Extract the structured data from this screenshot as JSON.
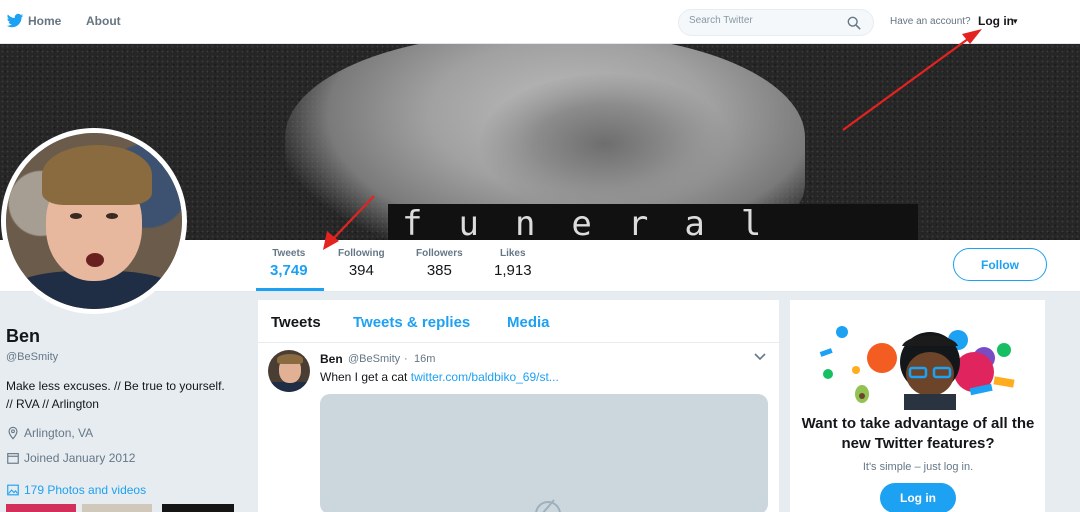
{
  "nav": {
    "brand_icon": "twitter-bird-icon",
    "home_label": "Home",
    "about_label": "About",
    "search_placeholder": "Search Twitter",
    "have_account_text": "Have an account?",
    "login_label": "Log in",
    "login_caret": "▾"
  },
  "banner": {
    "text": "funeral"
  },
  "stats": {
    "tweets": {
      "label": "Tweets",
      "value": "3,749"
    },
    "following": {
      "label": "Following",
      "value": "394"
    },
    "followers": {
      "label": "Followers",
      "value": "385"
    },
    "likes": {
      "label": "Likes",
      "value": "1,913"
    },
    "follow_button": "Follow"
  },
  "profile": {
    "name": "Ben",
    "handle": "@BeSmity",
    "bio_line1": "Make less excuses. // Be true to yourself.",
    "bio_line2": "// RVA // Arlington",
    "location": "Arlington, VA",
    "joined": "Joined January 2012",
    "photos_link": "179 Photos and videos"
  },
  "timeline": {
    "tabs": [
      {
        "label": "Tweets",
        "active": true
      },
      {
        "label": "Tweets & replies",
        "active": false
      },
      {
        "label": "Media",
        "active": false
      }
    ],
    "tweet": {
      "name": "Ben",
      "handle": "@BeSmity",
      "separator": "·",
      "time": "16m",
      "text": "When I get a cat",
      "link": "twitter.com/baldbiko_69/st..."
    }
  },
  "promo": {
    "title": "Want to take advantage of all the new Twitter features?",
    "subtitle": "It's simple – just log in.",
    "login_button": "Log in"
  },
  "colors": {
    "accent": "#1da1f2",
    "annotation_arrow": "#e3231f"
  }
}
